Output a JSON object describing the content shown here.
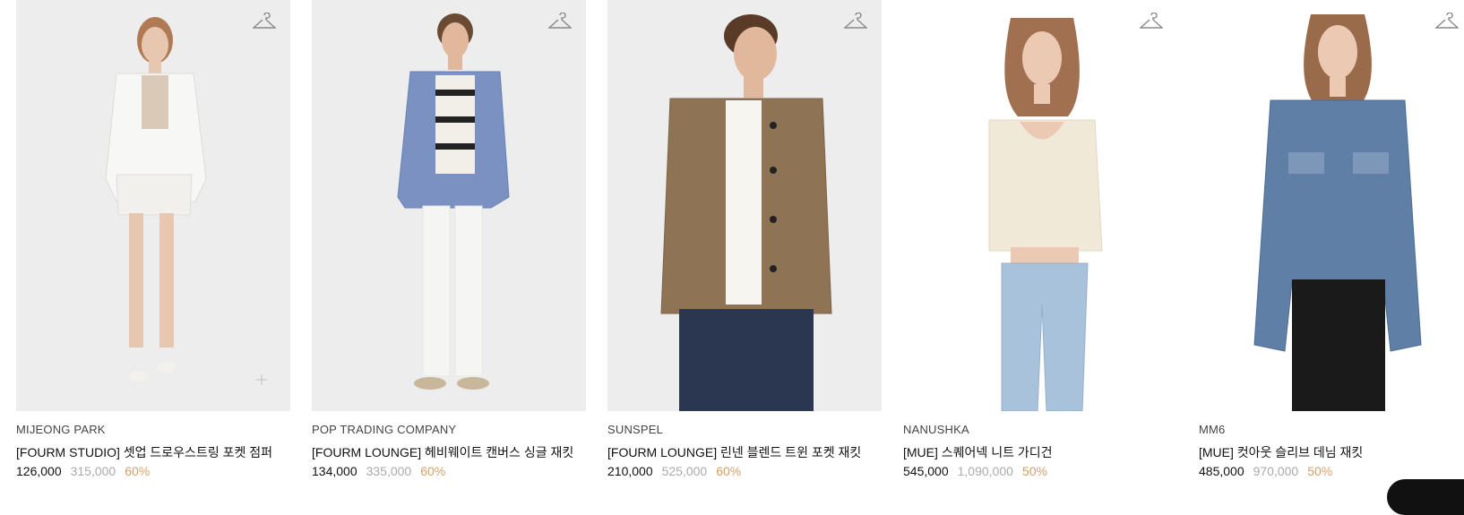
{
  "products": [
    {
      "brand": "MIJEONG PARK",
      "name": "[FOURM STUDIO] 셋업 드로우스트링 포켓 점퍼",
      "price": "126,000",
      "original_price": "315,000",
      "discount": "60%",
      "colors": {
        "bg": "#ededed",
        "top": "#f7f7f5",
        "bottom": "#f2f0ed",
        "skin": "#e8c7b0",
        "hair": "#b07a55"
      }
    },
    {
      "brand": "POP TRADING COMPANY",
      "name": "[FOURM LOUNGE] 헤비웨이트 캔버스 싱글 재킷",
      "price": "134,000",
      "original_price": "335,000",
      "discount": "60%",
      "colors": {
        "bg": "#ededed",
        "top": "#7a91c2",
        "bottom": "#f5f5f3",
        "skin": "#e2b89d",
        "hair": "#6a4a33"
      }
    },
    {
      "brand": "SUNSPEL",
      "name": "[FOURM LOUNGE] 린넨 블렌드 트윈 포켓 재킷",
      "price": "210,000",
      "original_price": "525,000",
      "discount": "60%",
      "colors": {
        "bg": "#ededed",
        "top": "#8f7355",
        "bottom": "#2b3650",
        "skin": "#e2b89d",
        "hair": "#5a3b27"
      }
    },
    {
      "brand": "NANUSHKA",
      "name": "[MUE] 스퀘어넥 니트 가디건",
      "price": "545,000",
      "original_price": "1,090,000",
      "discount": "50%",
      "colors": {
        "bg": "#ffffff",
        "top": "#f1e9d8",
        "bottom": "#a9c2dc",
        "skin": "#ecc9b3",
        "hair": "#a07050"
      }
    },
    {
      "brand": "MM6",
      "name": "[MUE] 컷아웃 슬리브 데님 재킷",
      "price": "485,000",
      "original_price": "970,000",
      "discount": "50%",
      "colors": {
        "bg": "#ffffff",
        "top": "#5f7fa6",
        "bottom": "#1a1a1a",
        "skin": "#ecc9b3",
        "hair": "#9a6b4a"
      }
    }
  ]
}
